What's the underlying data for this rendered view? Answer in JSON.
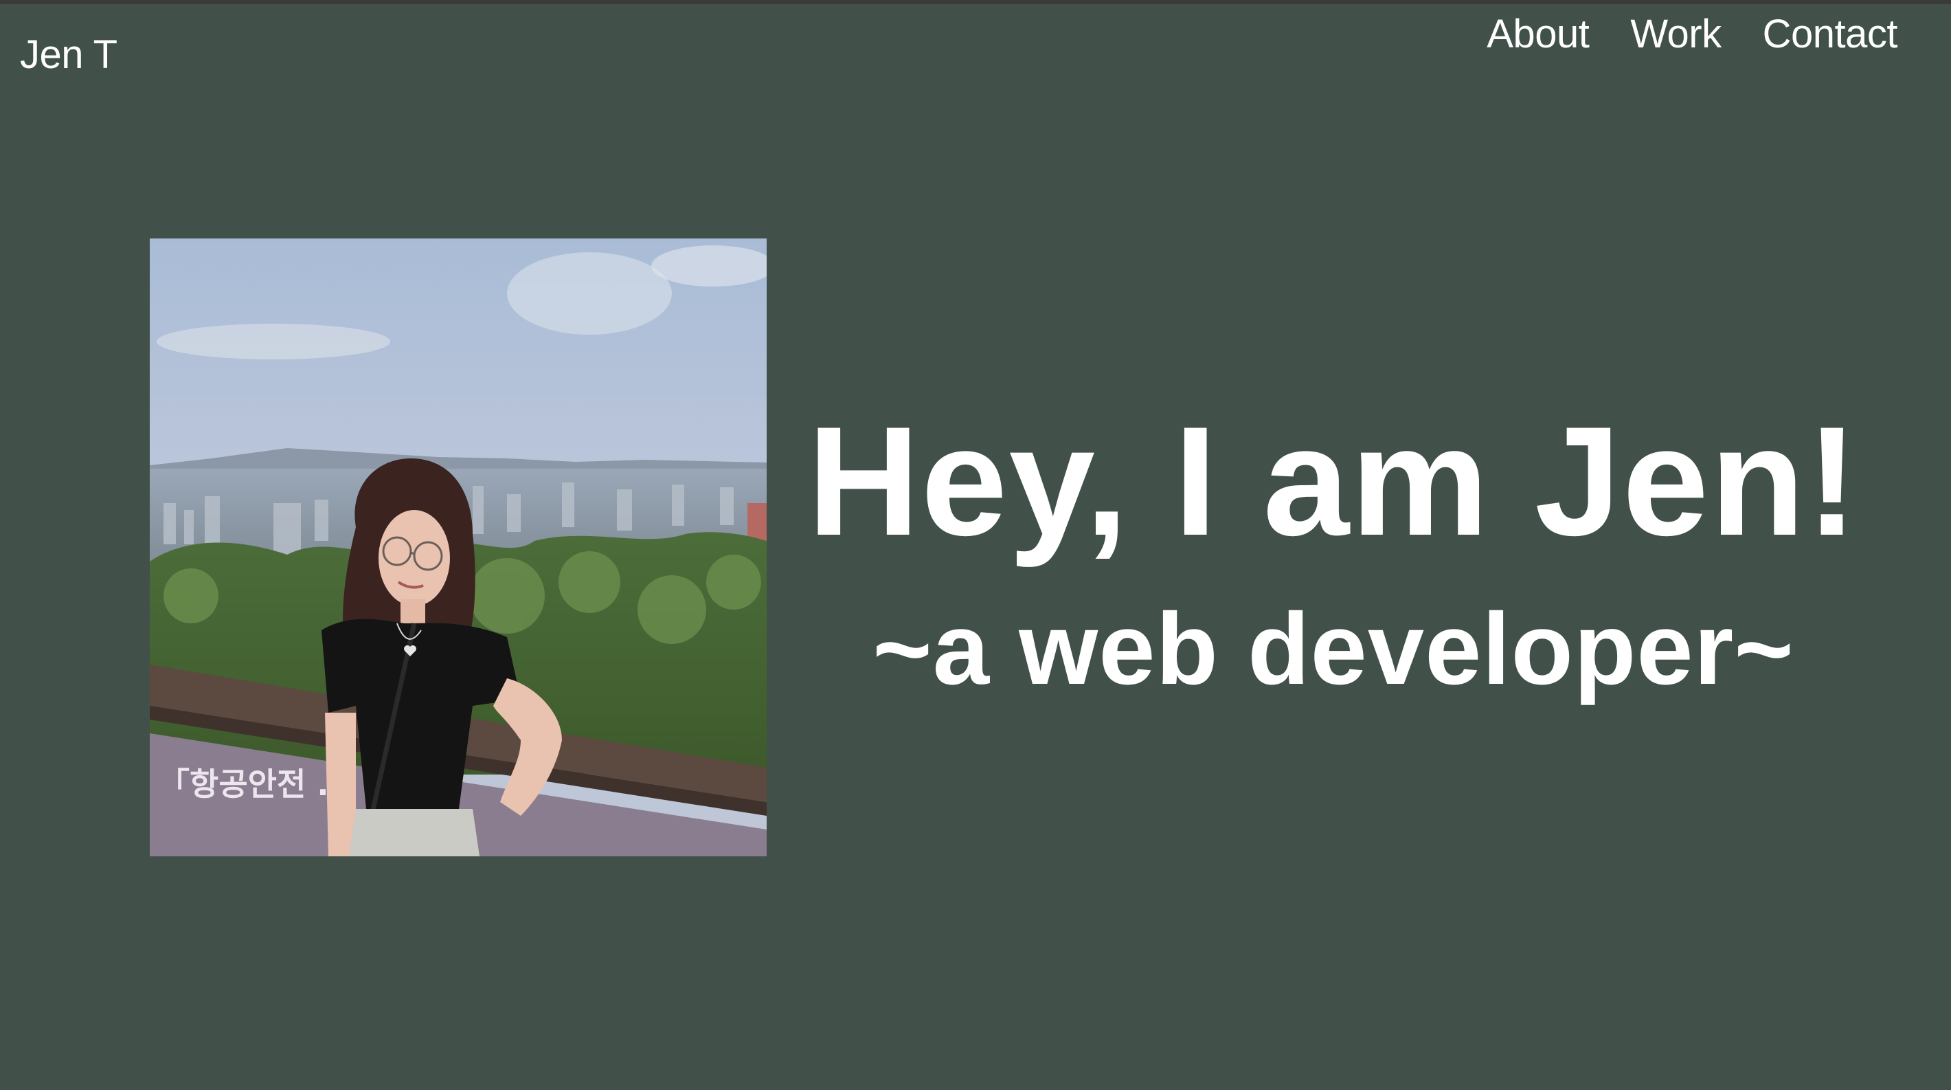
{
  "header": {
    "brand": "Jen T",
    "nav": [
      {
        "label": "About"
      },
      {
        "label": "Work"
      },
      {
        "label": "Contact"
      }
    ]
  },
  "hero": {
    "photo_icon": "profile-photo",
    "photo_sign_text": "「항공안전 ... 인가",
    "headline": "Hey, I am Jen!",
    "subheadline": "~a web developer~"
  },
  "colors": {
    "background": "#415149",
    "text": "#ffffff"
  }
}
